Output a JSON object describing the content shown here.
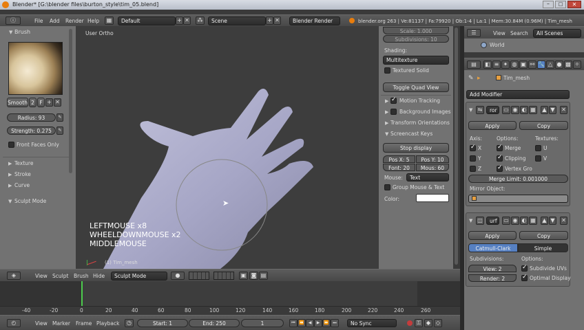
{
  "window": {
    "title": "Blender* [G:\\blender files\\burton_style\\tim_05.blend]"
  },
  "info_bar": {
    "menus": [
      "File",
      "Add",
      "Render",
      "Help"
    ],
    "layout": "Default",
    "scene": "Scene",
    "engine": "Blender Render",
    "stats": "blender.org 263 | Ve:81137 | Fa:79920 | Ob:1-4 | La:1 | Mem:30.84M (0.96M) | Tim_mesh"
  },
  "tool_shelf": {
    "brush_header": "Brush",
    "smooth_label": "Smooth",
    "smooth_num": "2",
    "f_label": "F",
    "radius": "Radius: 93",
    "strength": "Strength: 0.275",
    "front_faces": "Front Faces Only",
    "sections": [
      "Texture",
      "Stroke",
      "Curve"
    ],
    "mode_label": "Sculpt Mode"
  },
  "viewport": {
    "view_label": "User Ortho",
    "object_label": "(1) Tim_mesh",
    "overlay_lines": [
      "LEFTMOUSE x8",
      "WHEELDOWNMOUSE x2",
      "MIDDLEMOUSE"
    ]
  },
  "properties_n": {
    "scale": "Scale: 1.000",
    "subdivisions": "Subdivisions: 10",
    "shading_label": "Shading:",
    "shading_value": "Multitexture",
    "textured_solid": "Textured Solid",
    "toggle_quad": "Toggle Quad View",
    "motion_tracking": "Motion Tracking",
    "background_images": "Background Images",
    "transform_orientations": "Transform Orientations",
    "screencast_keys": "Screencast Keys",
    "stop_display": "Stop display",
    "pos_x": "Pos X: 5",
    "pos_y": "Pos Y: 10",
    "font": "Font: 20",
    "mouse_ms": "Mous: 60",
    "mouse_label": "Mouse:",
    "mouse_value": "Text",
    "group_mouse": "Group Mouse & Text",
    "color_label": "Color:"
  },
  "outliner": {
    "menus": [
      "View",
      "Search"
    ],
    "filter": "All Scenes",
    "world": "World"
  },
  "modifiers": {
    "object_name": "Tim_mesh",
    "add_modifier": "Add Modifier",
    "mirror": {
      "name": "ror",
      "apply": "Apply",
      "copy": "Copy",
      "axis_label": "Axis:",
      "options_label": "Options:",
      "textures_label": "Textures:",
      "x": "X",
      "y": "Y",
      "z": "Z",
      "merge": "Merge",
      "clipping": "Clipping",
      "vertex_groups": "Vertex Gro",
      "u": "U",
      "v": "V",
      "merge_limit": "Merge Limit: 0.001000",
      "mirror_object": "Mirror Object:"
    },
    "subsurf": {
      "name": "urf",
      "apply": "Apply",
      "copy": "Copy",
      "catmull": "Catmull-Clark",
      "simple": "Simple",
      "subdivisions_label": "Subdivisions:",
      "options_label": "Options:",
      "view": "View: 2",
      "render": "Render: 2",
      "subdivide_uvs": "Subdivide UVs",
      "optimal_display": "Optimal Display"
    }
  },
  "view3d_header": {
    "menus": [
      "View",
      "Sculpt",
      "Brush",
      "Hide"
    ],
    "mode": "Sculpt Mode"
  },
  "timeline": {
    "ticks": [
      "-40",
      "-20",
      "0",
      "20",
      "40",
      "60",
      "80",
      "100",
      "120",
      "140",
      "160",
      "180",
      "200",
      "220",
      "240",
      "260"
    ],
    "menus": [
      "View",
      "Marker",
      "Frame",
      "Playback"
    ],
    "start": "Start: 1",
    "end": "End: 250",
    "current": "1",
    "sync": "No Sync"
  },
  "colors": {
    "accent": "#5680c2",
    "viewport_bg": "#3d3d3d",
    "panel_bg": "#727272",
    "hand": "#b0b0d0"
  }
}
